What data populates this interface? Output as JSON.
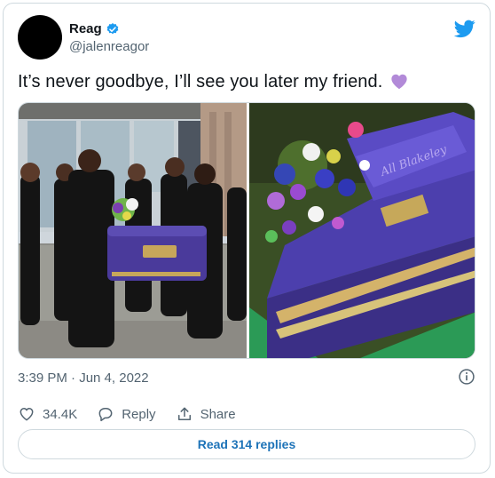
{
  "author": {
    "name": "Reag",
    "handle": "@jalenreagor"
  },
  "tweet": {
    "text": "It’s never goodbye, I’ll see you later my friend."
  },
  "media": {
    "left_alt": "Pallbearers in black carrying a purple casket",
    "right_alt": "Purple casket with flowers",
    "casket_script": "All Blakeley"
  },
  "meta": {
    "time": "3:39 PM · Jun 4, 2022"
  },
  "actions": {
    "likes": "34.4K",
    "reply_label": "Reply",
    "share_label": "Share"
  },
  "replies_button": "Read 314 replies",
  "colors": {
    "twitter_blue": "#1d9bf0",
    "heart_purple": "#b28ad8",
    "casket_purple": "#4a3a9b"
  }
}
